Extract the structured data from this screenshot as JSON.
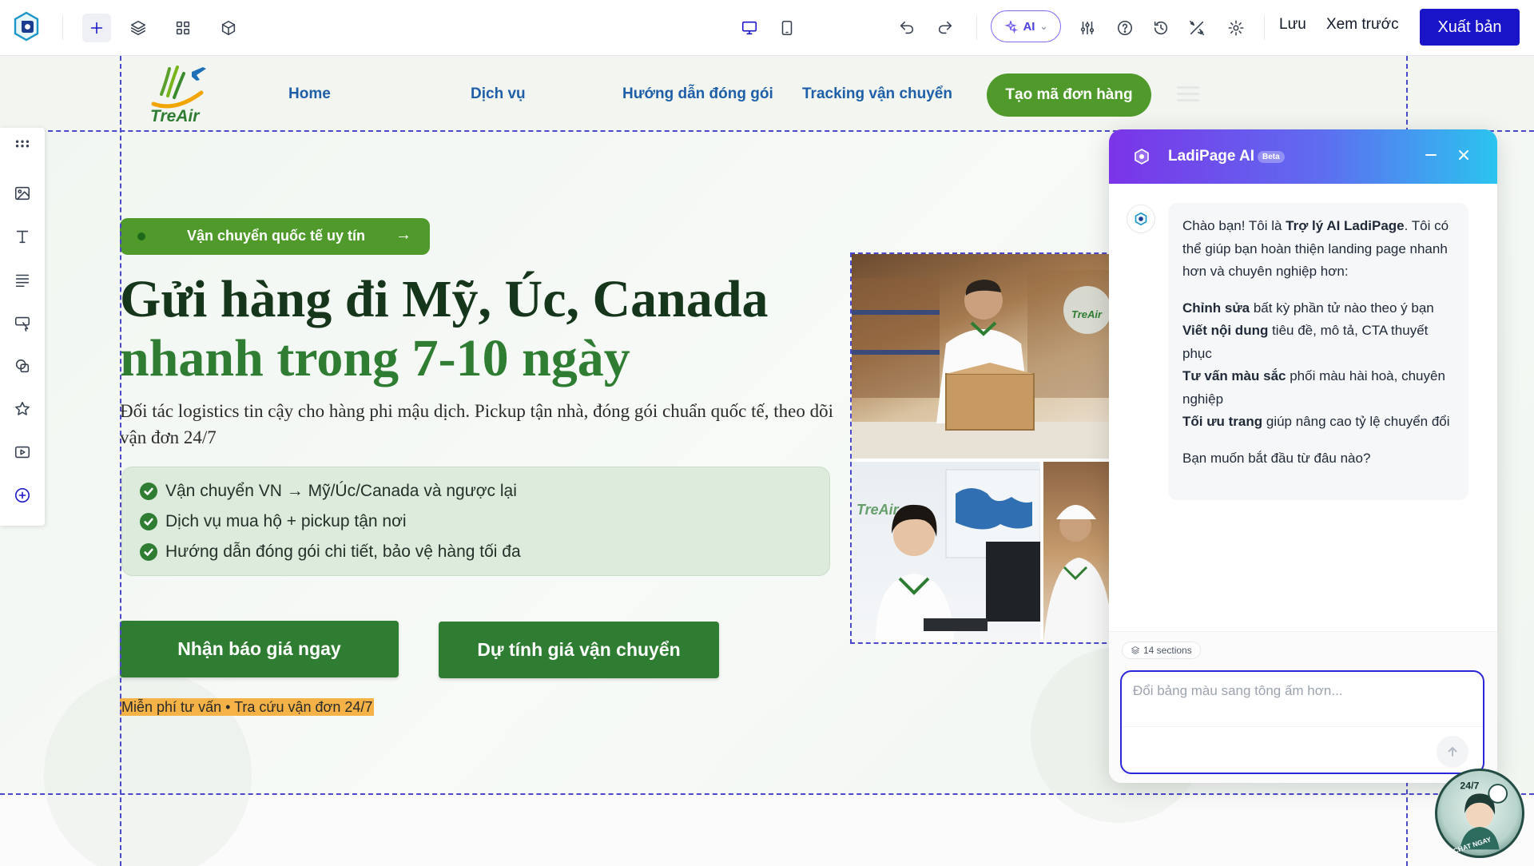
{
  "toolbar": {
    "logo_icon": "ladipage-logo-icon",
    "left_tools": [
      "plus-icon",
      "layers-icon",
      "grid-icon",
      "cube-icon"
    ],
    "device_tools": [
      "desktop-icon",
      "tablet-icon"
    ],
    "right_tools": [
      "undo-icon",
      "redo-icon"
    ],
    "ai_label": "AI",
    "util_tools": [
      "sliders-icon",
      "help-icon",
      "history-icon",
      "magic-icon",
      "gear-icon"
    ],
    "save_label": "Lưu",
    "preview_label": "Xem trước",
    "publish_label": "Xuất bản"
  },
  "site_header": {
    "brand_name": "TreAir",
    "nav": [
      "Home",
      "Dịch vụ",
      "Hướng dẫn đóng gói",
      "Tracking vận chuyển"
    ],
    "cta": "Tạo mã đơn hàng"
  },
  "hero": {
    "badge": "Vận chuyển quốc tế uy tín",
    "badge_arrow": "→",
    "title_line1": "Gửi hàng đi Mỹ, Úc, Canada",
    "title_line2": "nhanh trong 7-10 ngày",
    "subtitle": "Đối tác logistics tin cậy cho hàng phi mậu dịch. Pickup tận nhà, đóng gói chuẩn quốc tế, theo dõi vận đơn 24/7",
    "features": [
      "Vận chuyển VN → Mỹ/Úc/Canada và ngược lại",
      "Dịch vụ mua hộ + pickup tận nơi",
      "Hướng dẫn đóng gói chi tiết, bảo vệ hàng tối đa"
    ],
    "primary_cta": "Nhận báo giá ngay",
    "secondary_cta": "Dự tính giá vận chuyển",
    "note": "Miễn phí tư vấn • Tra cứu vận đơn 24/7"
  },
  "side_tools": [
    "drag-handle-icon",
    "image-icon",
    "text-icon",
    "paragraph-icon",
    "button-icon",
    "shape-icon",
    "star-icon",
    "video-icon",
    "add-icon"
  ],
  "ai_panel": {
    "title": "LadiPage AI",
    "beta": "Beta",
    "greeting_pre": "Chào bạn! Tôi là ",
    "greeting_name": "Trợ lý AI LadiPage",
    "greeting_post": ". Tôi có thể giúp bạn hoàn thiện landing page nhanh hơn và chuyên nghiệp hơn:",
    "capabilities": [
      {
        "title": "Chỉnh sửa",
        "desc": " bất kỳ phần tử nào theo ý bạn"
      },
      {
        "title": "Viết nội dung",
        "desc": " tiêu đề, mô tả, CTA thuyết phục"
      },
      {
        "title": "Tư vấn màu sắc",
        "desc": " phối màu hài hoà, chuyên nghiệp"
      },
      {
        "title": "Tối ưu trang",
        "desc": " giúp nâng cao tỷ lệ chuyển đổi"
      }
    ],
    "question": "Bạn muốn bắt đầu từ đâu nào?",
    "sections_chip": "14 sections",
    "input_placeholder": "Đổi bảng màu sang tông ấm hơn..."
  },
  "chat_widget": {
    "label_top": "24/7",
    "label_bottom": "CHAT NGAY"
  },
  "colors": {
    "brand_green": "#2e7d32",
    "lime_green": "#4f9a2a",
    "nav_blue": "#1e5fa8",
    "publish_blue": "#1a14c9",
    "guide_dash": "#4b49c9"
  }
}
